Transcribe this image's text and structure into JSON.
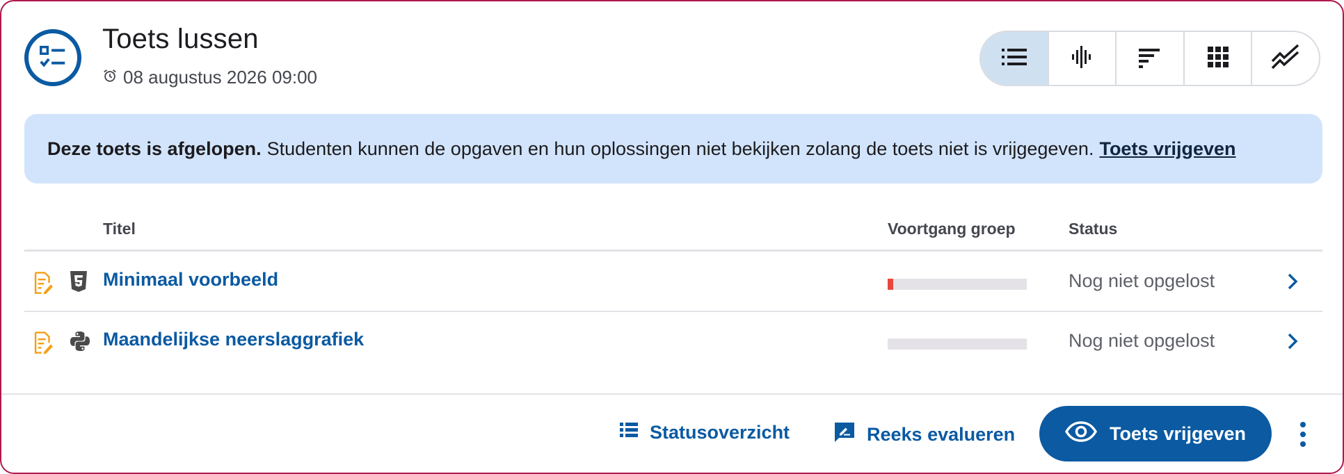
{
  "header": {
    "title": "Toets lussen",
    "datetime": "08 augustus 2026 09:00",
    "icon": "checklist-icon",
    "views": [
      {
        "icon": "list-icon",
        "active": true
      },
      {
        "icon": "waveform-icon",
        "active": false
      },
      {
        "icon": "sorted-bars-icon",
        "active": false
      },
      {
        "icon": "grid-icon",
        "active": false
      },
      {
        "icon": "trend-chart-icon",
        "active": false
      }
    ]
  },
  "alert": {
    "strong": "Deze toets is afgelopen.",
    "text": "Studenten kunnen de opgaven en hun oplossingen niet bekijken zolang de toets niet is vrijgegeven.",
    "link": "Toets vrijgeven"
  },
  "table": {
    "headers": {
      "title": "Titel",
      "progress": "Voortgang groep",
      "status": "Status"
    },
    "rows": [
      {
        "title": "Minimaal voorbeeld",
        "lang_icon": "html5-icon",
        "progress": 0.04,
        "status": "Nog niet opgelost"
      },
      {
        "title": "Maandelijkse neerslaggrafiek",
        "lang_icon": "python-icon",
        "progress": 0,
        "status": "Nog niet opgelost"
      }
    ]
  },
  "footer": {
    "status_overview": "Statusoverzicht",
    "evaluate": "Reeks evalueren",
    "release": "Toets vrijgeven"
  },
  "colors": {
    "primary": "#0b5aa2",
    "alert_bg": "#d2e4fb",
    "border": "#b0174f",
    "progress_fill": "#e9473c",
    "doc_icon": "#f59f16"
  }
}
